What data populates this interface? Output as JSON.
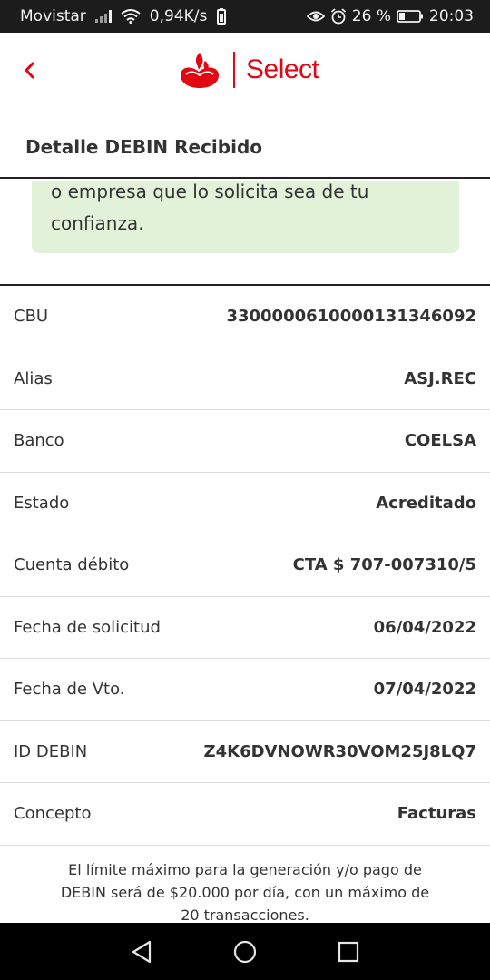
{
  "status_bar": {
    "carrier": "Movistar",
    "speed": "0,94K/s",
    "battery": "26 %",
    "time": "20:03"
  },
  "header": {
    "brand": "Select",
    "title": "Detalle DEBIN Recibido"
  },
  "notice": {
    "line1": "o empresa que lo solicita sea de tu",
    "line2": "confianza."
  },
  "details": [
    {
      "label": "CBU",
      "value": "3300000610000131346092"
    },
    {
      "label": "Alias",
      "value": "ASJ.REC"
    },
    {
      "label": "Banco",
      "value": "COELSA"
    },
    {
      "label": "Estado",
      "value": "Acreditado"
    },
    {
      "label": "Cuenta débito",
      "value": "CTA $ 707-007310/5"
    },
    {
      "label": "Fecha de solicitud",
      "value": "06/04/2022"
    },
    {
      "label": "Fecha de Vto.",
      "value": "07/04/2022"
    },
    {
      "label": "ID DEBIN",
      "value": "Z4K6DVNOWR30VOM25J8LQ7"
    },
    {
      "label": "Concepto",
      "value": "Facturas"
    }
  ],
  "footer": {
    "line1": "El límite máximo para la generación y/o pago de",
    "line2": "DEBIN será de $20.000 por día, con un máximo de",
    "line3": "20 transacciones."
  },
  "colors": {
    "brand_red": "#e30613",
    "notice_bg": "#e2f2d9"
  }
}
